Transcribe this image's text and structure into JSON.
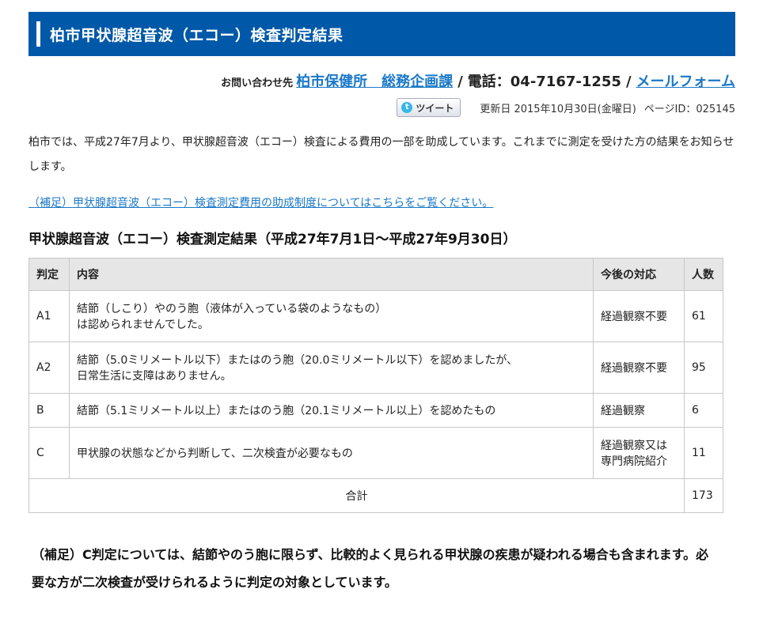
{
  "header": {
    "title": "柏市甲状腺超音波（エコー）検査判定結果"
  },
  "contact": {
    "label": "お問い合わせ先",
    "dept_link": "柏市保健所　総務企画課",
    "separator": "/",
    "tel": "電話：04-7167-1255",
    "mail_link": "メールフォーム"
  },
  "meta": {
    "tweet_label": "ツイート",
    "updated": "更新日 2015年10月30日(金曜日)",
    "page_id": "ページID：025145"
  },
  "intro": "柏市では、平成27年7月より、甲状腺超音波（エコー）検査による費用の一部を助成しています。これまでに測定を受けた方の結果をお知らせします。",
  "supplement_link": "（補足）甲状腺超音波（エコー）検査測定費用の助成制度についてはこちらをご覧ください。",
  "results": {
    "heading": "甲状腺超音波（エコー）検査測定結果（平成27年7月1日～平成27年9月30日）",
    "columns": {
      "judgment": "判定",
      "content": "内容",
      "response": "今後の対応",
      "count": "人数"
    },
    "rows": [
      {
        "judgment": "A1",
        "content_line1": "結節（しこり）やのう胞（液体が入っている袋のようなもの）",
        "content_line2": "は認められませんでした。",
        "response_line1": "経過観察不要",
        "response_line2": "",
        "count": "61"
      },
      {
        "judgment": "A2",
        "content_line1": "結節（5.0ミリメートル以下）またはのう胞（20.0ミリメートル以下）を認めましたが、",
        "content_line2": "日常生活に支障はありません。",
        "response_line1": "経過観察不要",
        "response_line2": "",
        "count": "95"
      },
      {
        "judgment": "B",
        "content_line1": "結節（5.1ミリメートル以上）またはのう胞（20.1ミリメートル以上）を認めたもの",
        "content_line2": "",
        "response_line1": "経過観察",
        "response_line2": "",
        "count": "6"
      },
      {
        "judgment": "C",
        "content_line1": "甲状腺の状態などから判断して、二次検査が必要なもの",
        "content_line2": "",
        "response_line1": "経過観察又は",
        "response_line2": "専門病院紹介",
        "count": "11"
      }
    ],
    "total_label": "合計",
    "total_count": "173"
  },
  "note": "（補足）C判定については、結節やのう胞に限らず、比較的よく見られる甲状腺の疾患が疑われる場合も含まれます。必要な方が二次検査が受けられるように判定の対象としています。",
  "colors": {
    "header_bg": "#0058a8",
    "link": "#1a78c8",
    "table_header_bg": "#e6e6e6"
  }
}
